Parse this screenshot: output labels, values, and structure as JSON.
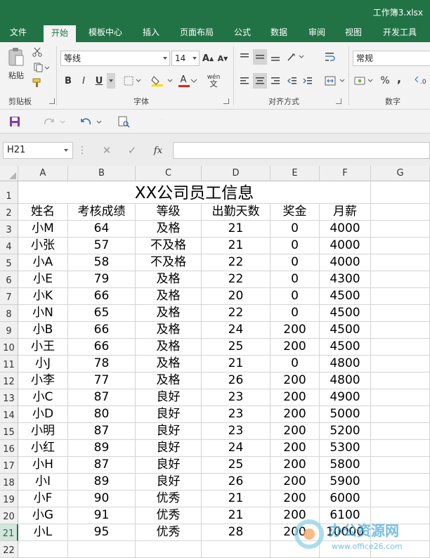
{
  "app": {
    "file_title": "工作簿3.xlsx"
  },
  "ribbon_tabs": [
    "文件",
    "开始",
    "模板中心",
    "插入",
    "页面布局",
    "公式",
    "数据",
    "审阅",
    "视图",
    "开发工具"
  ],
  "active_tab": "开始",
  "ribbon": {
    "clipboard": {
      "paste_label": "粘贴",
      "group_label": "剪贴板"
    },
    "font": {
      "font_name": "等线",
      "font_size": "14",
      "group_label": "字体",
      "bold": "B",
      "italic": "I",
      "underline": "U",
      "grow": "A",
      "shrink": "A",
      "font_color": "A",
      "phonetic": "wén"
    },
    "alignment": {
      "group_label": "对齐方式"
    },
    "number": {
      "format": "常规",
      "group_label": "数字",
      "percent": "%",
      "comma": ","
    }
  },
  "formula_bar": {
    "name_box": "H21",
    "cancel": "✕",
    "enter": "✓",
    "fx": "fx",
    "formula": ""
  },
  "sheet": {
    "columns": [
      "A",
      "B",
      "C",
      "D",
      "E",
      "F",
      "G"
    ],
    "title": "XX公司员工信息",
    "headers": [
      "姓名",
      "考核成绩",
      "等级",
      "出勤天数",
      "奖金",
      "月薪"
    ],
    "rows": [
      [
        "小M",
        "64",
        "及格",
        "21",
        "0",
        "4000"
      ],
      [
        "小张",
        "57",
        "不及格",
        "21",
        "0",
        "4000"
      ],
      [
        "小A",
        "58",
        "不及格",
        "22",
        "0",
        "4000"
      ],
      [
        "小E",
        "79",
        "及格",
        "22",
        "0",
        "4300"
      ],
      [
        "小K",
        "66",
        "及格",
        "20",
        "0",
        "4500"
      ],
      [
        "小N",
        "65",
        "及格",
        "22",
        "0",
        "4500"
      ],
      [
        "小B",
        "66",
        "及格",
        "24",
        "200",
        "4500"
      ],
      [
        "小王",
        "66",
        "及格",
        "25",
        "200",
        "4500"
      ],
      [
        "小J",
        "78",
        "及格",
        "21",
        "0",
        "4800"
      ],
      [
        "小李",
        "77",
        "及格",
        "26",
        "200",
        "4800"
      ],
      [
        "小C",
        "87",
        "良好",
        "23",
        "200",
        "4900"
      ],
      [
        "小D",
        "80",
        "良好",
        "23",
        "200",
        "5000"
      ],
      [
        "小明",
        "87",
        "良好",
        "23",
        "200",
        "5200"
      ],
      [
        "小红",
        "89",
        "良好",
        "24",
        "200",
        "5300"
      ],
      [
        "小H",
        "87",
        "良好",
        "25",
        "200",
        "5800"
      ],
      [
        "小I",
        "89",
        "良好",
        "26",
        "200",
        "5900"
      ],
      [
        "小F",
        "90",
        "优秀",
        "21",
        "200",
        "6000"
      ],
      [
        "小G",
        "91",
        "优秀",
        "21",
        "200",
        "6100"
      ],
      [
        "小L",
        "95",
        "优秀",
        "28",
        "200",
        "10000"
      ]
    ],
    "selected_row": "21",
    "extra_row": "22"
  },
  "watermark": {
    "brand": "office26",
    "text_cn": "办公资源网",
    "url": "www.office26.com"
  },
  "colors": {
    "excel_green": "#217346"
  }
}
